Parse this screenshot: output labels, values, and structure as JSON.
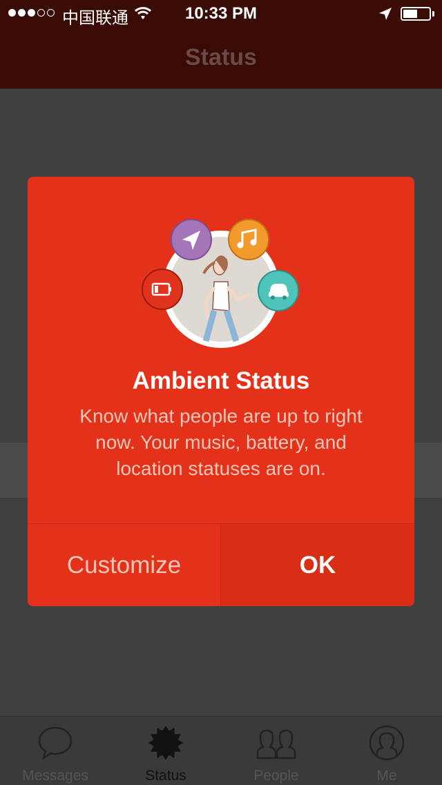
{
  "statusbar": {
    "carrier": "中国联通",
    "time": "10:33 PM",
    "signal_strength": 3,
    "battery_level": 0.55,
    "icons": [
      "signal-dots-icon",
      "wifi-icon",
      "location-arrow-icon",
      "battery-icon"
    ]
  },
  "navbar": {
    "title": "Status"
  },
  "modal": {
    "title": "Ambient Status",
    "body": "Know what people are up to right now. Your music, battery, and location statuses are on.",
    "illustration_icons": [
      "location-icon",
      "music-icon",
      "battery-icon",
      "car-icon",
      "walking-woman-illustration"
    ],
    "colors": {
      "background": "#e43119",
      "location": "#a475b8",
      "music": "#f39a2d",
      "battery": "#e0321c",
      "car": "#4ec4bb"
    },
    "customize_label": "Customize",
    "ok_label": "OK"
  },
  "tabbar": {
    "tabs": [
      {
        "label": "Messages",
        "icon": "speech-bubble-icon",
        "active": false
      },
      {
        "label": "Status",
        "icon": "starburst-icon",
        "active": true
      },
      {
        "label": "People",
        "icon": "people-icon",
        "active": false
      },
      {
        "label": "Me",
        "icon": "person-circle-icon",
        "active": false
      }
    ]
  }
}
